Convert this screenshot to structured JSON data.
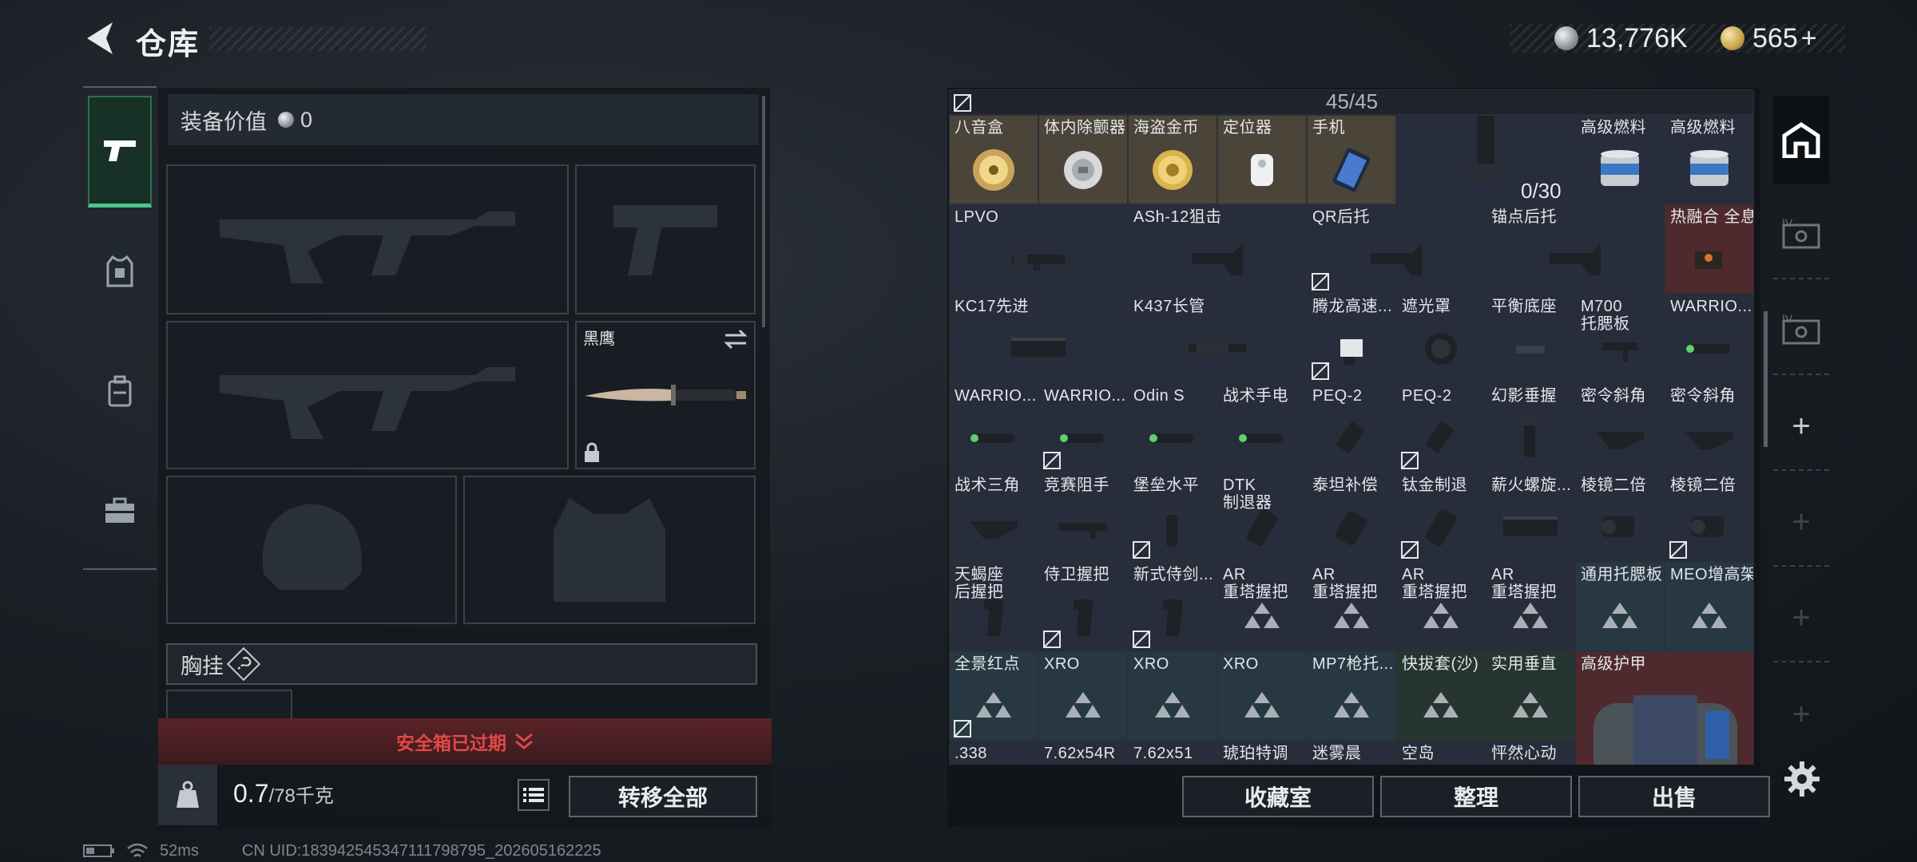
{
  "header": {
    "title": "仓库"
  },
  "currency": {
    "silver": "13,776K",
    "gold": "565",
    "gold_add": "+"
  },
  "equipment": {
    "value_label": "装备价值",
    "value": "0",
    "knife_name": "黑鹰",
    "chest_label": "胸挂",
    "chest_help": "?"
  },
  "safe_box": {
    "expired_text": "安全箱已过期"
  },
  "weight": {
    "current": "0.7",
    "max": "/78千克"
  },
  "buttons": {
    "transfer_all": "转移全部",
    "collection": "收藏室",
    "organize": "整理",
    "sell": "出售"
  },
  "stash": {
    "capacity": "45/45",
    "stack_count": "0/30"
  },
  "status": {
    "ping": "52ms",
    "uid": "CN UID:183942545347111798795_202605162225"
  },
  "colors": {
    "accent_green": "#4fc48e",
    "expired_red": "#e24848",
    "panel": "#272d3a"
  },
  "grid": {
    "row0": [
      {
        "name": "八音盒",
        "icon": "music-box-icon",
        "bg": "tan"
      },
      {
        "name": "体内除颤器",
        "icon": "defibrillator-icon",
        "bg": "tan"
      },
      {
        "name": "海盗金币",
        "icon": "gold-coin-icon",
        "bg": "tan"
      },
      {
        "name": "定位器",
        "icon": "tracker-icon",
        "bg": "tan"
      },
      {
        "name": "手机",
        "icon": "phone-icon",
        "bg": "tan"
      },
      {
        "name": "高级燃料",
        "icon": "fuel-can-icon",
        "bg": "blue"
      },
      {
        "name": "高级燃料",
        "icon": "fuel-can-icon",
        "bg": "blue"
      }
    ],
    "row1": [
      {
        "name": "LPVO",
        "icon": "scope-icon"
      },
      {
        "name": "ASh-12狙击",
        "icon": "stock-icon"
      },
      {
        "name": "QR后托",
        "icon": "stock-icon"
      },
      {
        "name": "锚点后托",
        "icon": "stock-icon"
      },
      {
        "name": "热融合 全息",
        "icon": "holo-sight-icon"
      }
    ],
    "row2": [
      {
        "name": "KC17先进",
        "icon": "handguard-icon"
      },
      {
        "name": "K437长管",
        "icon": "barrel-icon"
      },
      {
        "name": "腾龙高速...",
        "icon": "mount-icon"
      },
      {
        "name": "遮光罩",
        "icon": "sunshade-icon"
      },
      {
        "name": "平衡底座",
        "icon": "base-icon"
      },
      {
        "name": "M700\n托腮板",
        "icon": "cheek-rest-icon"
      },
      {
        "name": "WARRIO...",
        "icon": "flashlight-icon"
      }
    ],
    "row3": [
      {
        "name": "WARRIO...",
        "icon": "flashlight-icon"
      },
      {
        "name": "WARRIO...",
        "icon": "flashlight-icon"
      },
      {
        "name": "Odin S",
        "icon": "flashlight-icon"
      },
      {
        "name": "战术手电",
        "icon": "flashlight-icon"
      },
      {
        "name": "PEQ-2",
        "icon": "laser-icon"
      },
      {
        "name": "PEQ-2",
        "icon": "laser-icon"
      },
      {
        "name": "幻影垂握",
        "icon": "grip-icon"
      },
      {
        "name": "密令斜角",
        "icon": "angled-grip-icon"
      },
      {
        "name": "密令斜角",
        "icon": "angled-grip-icon"
      }
    ],
    "row4": [
      {
        "name": "战术三角",
        "icon": "angled-grip-icon"
      },
      {
        "name": "竞赛阻手",
        "icon": "handstop-icon"
      },
      {
        "name": "堡垒水平",
        "icon": "grip-icon"
      },
      {
        "name": "DTK\n制退器",
        "icon": "muzzle-brake-icon"
      },
      {
        "name": "泰坦补偿",
        "icon": "compensator-icon"
      },
      {
        "name": "钛金制退",
        "icon": "muzzle-brake-icon"
      },
      {
        "name": "薪火螺旋...",
        "icon": "handguard-icon"
      },
      {
        "name": "棱镜二倍",
        "icon": "prism-scope-icon"
      },
      {
        "name": "棱镜二倍",
        "icon": "prism-scope-icon"
      }
    ],
    "row5": [
      {
        "name": "天蝎座\n后握把",
        "icon": "pistol-grip-icon"
      },
      {
        "name": "侍卫握把",
        "icon": "pistol-grip-icon"
      },
      {
        "name": "新式侍剑...",
        "icon": "pistol-grip-icon"
      },
      {
        "name": "AR\n重塔握把",
        "icon": "placeholder-icon"
      },
      {
        "name": "AR\n重塔握把",
        "icon": "placeholder-icon"
      },
      {
        "name": "AR\n重塔握把",
        "icon": "placeholder-icon"
      },
      {
        "name": "AR\n重塔握把",
        "icon": "placeholder-icon"
      },
      {
        "name": "通用托腮板",
        "icon": "placeholder-icon"
      },
      {
        "name": "MEO增高架",
        "icon": "placeholder-icon"
      }
    ],
    "row6": [
      {
        "name": "全景红点",
        "icon": "placeholder-icon"
      },
      {
        "name": "XRO",
        "icon": "placeholder-icon"
      },
      {
        "name": "XRO",
        "icon": "placeholder-icon"
      },
      {
        "name": "XRO",
        "icon": "placeholder-icon"
      },
      {
        "name": "MP7枪托...",
        "icon": "placeholder-icon"
      },
      {
        "name": "快拔套(沙)",
        "icon": "placeholder-icon"
      },
      {
        "name": "实用垂直",
        "icon": "placeholder-icon"
      },
      {
        "name": "高级护甲",
        "icon": "armor-bag-icon"
      }
    ],
    "row7": [
      {
        "name": ".338"
      },
      {
        "name": "7.62x54R"
      },
      {
        "name": "7.62x51"
      },
      {
        "name": "琥珀特调"
      },
      {
        "name": "迷雾晨"
      },
      {
        "name": "空岛"
      },
      {
        "name": "怦然心动"
      }
    ]
  }
}
